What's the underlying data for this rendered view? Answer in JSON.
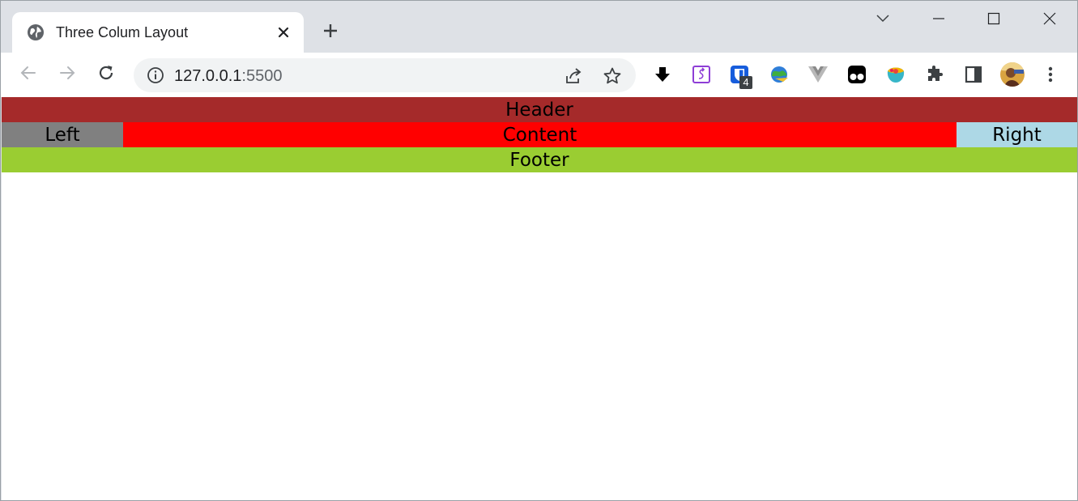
{
  "tab": {
    "title": "Three Colum Layout",
    "favicon": "globe-icon",
    "close_icon": "close-icon"
  },
  "tabstrip": {
    "new_tab_icon": "plus-icon",
    "tab_search_icon": "chevron-down-icon"
  },
  "window_controls": [
    "minimize-icon",
    "maximize-icon",
    "close-icon"
  ],
  "toolbar": {
    "back_icon": "back-arrow-icon",
    "forward_icon": "forward-arrow-icon",
    "reload_icon": "reload-icon",
    "url_host": "127.0.0.1",
    "url_port": ":5500",
    "site_info_icon": "info-icon",
    "share_icon": "share-icon",
    "bookmark_icon": "star-icon",
    "extensions": [
      {
        "name": "download-arrow-icon"
      },
      {
        "name": "purple-extension-icon"
      },
      {
        "name": "bitwarden-icon",
        "badge": "4"
      },
      {
        "name": "idm-globe-icon"
      },
      {
        "name": "vue-devtools-icon"
      },
      {
        "name": "tampermonkey-icon"
      },
      {
        "name": "colorful-ext-icon"
      },
      {
        "name": "puzzle-extensions-icon"
      },
      {
        "name": "side-panel-icon"
      },
      {
        "name": "profile-avatar"
      },
      {
        "name": "kebab-menu-icon"
      }
    ]
  },
  "page": {
    "header": {
      "label": "Header",
      "color": "#a52a2a"
    },
    "left": {
      "label": "Left",
      "color": "#808080"
    },
    "content": {
      "label": "Content",
      "color": "#ff0000"
    },
    "right": {
      "label": "Right",
      "color": "#add8e6"
    },
    "footer": {
      "label": "Footer",
      "color": "#9acd32"
    }
  }
}
